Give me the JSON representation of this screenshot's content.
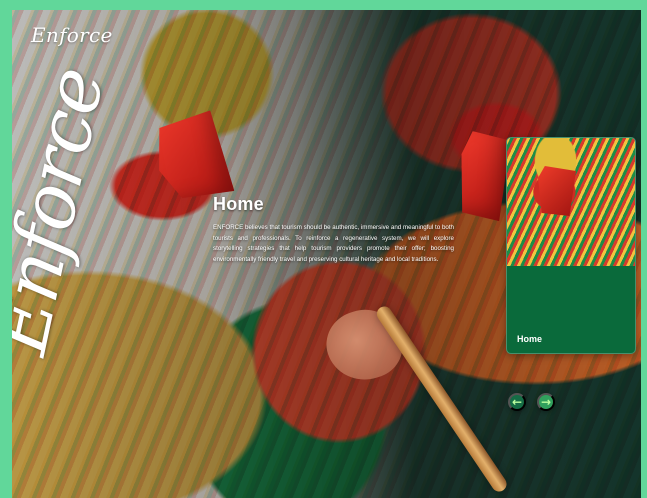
{
  "brand": {
    "logo": "Enforce",
    "watermark": "Enforce"
  },
  "hero": {
    "title": "Home",
    "body": "ENFORCE believes that tourism should be authentic, immersive and meaningful to both tourists and professionals. To reinforce a regenerative system, we will explore storytelling strategies that help tourism providers promote their offer; boosting environmentally friendly travel and preserving cultural heritage and local traditions."
  },
  "card": {
    "label": "Home"
  },
  "controls": {
    "previous_icon": "arrow-left-icon",
    "next_icon": "arrow-right-icon",
    "previous_glyph": "←",
    "next_glyph": "→"
  },
  "colors": {
    "page_border": "#61d79a",
    "card_background": "#0a6a3b",
    "previous_button": "#156c45",
    "next_button": "#31a05d"
  }
}
